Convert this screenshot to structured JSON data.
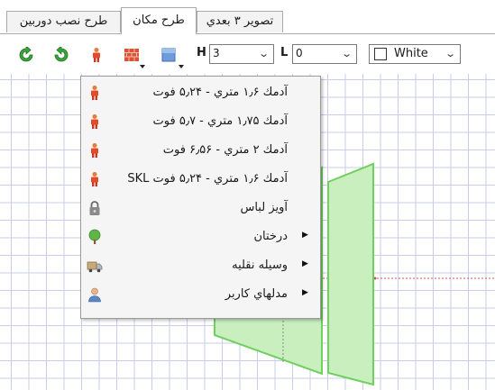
{
  "tabs": [
    {
      "label": "طرح نصب دوربين",
      "active": false
    },
    {
      "label": "طرح مكان",
      "active": true
    },
    {
      "label": "تصوير ۳ بعدي",
      "active": false
    }
  ],
  "toolbar": {
    "icons": [
      "refresh-green-icon",
      "refresh-green-alt-icon",
      "human-figure-icon",
      "brick-wall-icon",
      "blue-box-icon"
    ],
    "h_label": "H",
    "h_value": "3",
    "l_label": "L",
    "l_value": "0",
    "color_value": "White"
  },
  "menu": {
    "items": [
      {
        "label": "آدمك ۱٫۶ متري - ۵٫۲۴ فوت",
        "icon": "human-figure-icon",
        "has_submenu": false
      },
      {
        "label": "آدمك ۱٫۷۵ متري - ۵٫۷ فوت",
        "icon": "human-figure-icon",
        "has_submenu": false
      },
      {
        "label": "آدمك ۲ متري - ۶٫۵۶ فوت",
        "icon": "human-figure-icon",
        "has_submenu": false
      },
      {
        "label": "آدمك ۱٫۶ متري - ۵٫۲۴ فوت SKL",
        "icon": "human-figure-icon",
        "has_submenu": false
      },
      {
        "label": "آويز لباس",
        "icon": "padlock-icon",
        "has_submenu": false
      },
      {
        "label": "درختان",
        "icon": "tree-icon",
        "has_submenu": true
      },
      {
        "label": "وسيله نقليه",
        "icon": "truck-icon",
        "has_submenu": true
      },
      {
        "label": "مدلهاي كاربر",
        "icon": "user-icon",
        "has_submenu": true
      }
    ]
  },
  "colors": {
    "grid": "#c9cdea",
    "shape_fill": "#c9efbf",
    "shape_stroke": "#6fcf5f"
  }
}
